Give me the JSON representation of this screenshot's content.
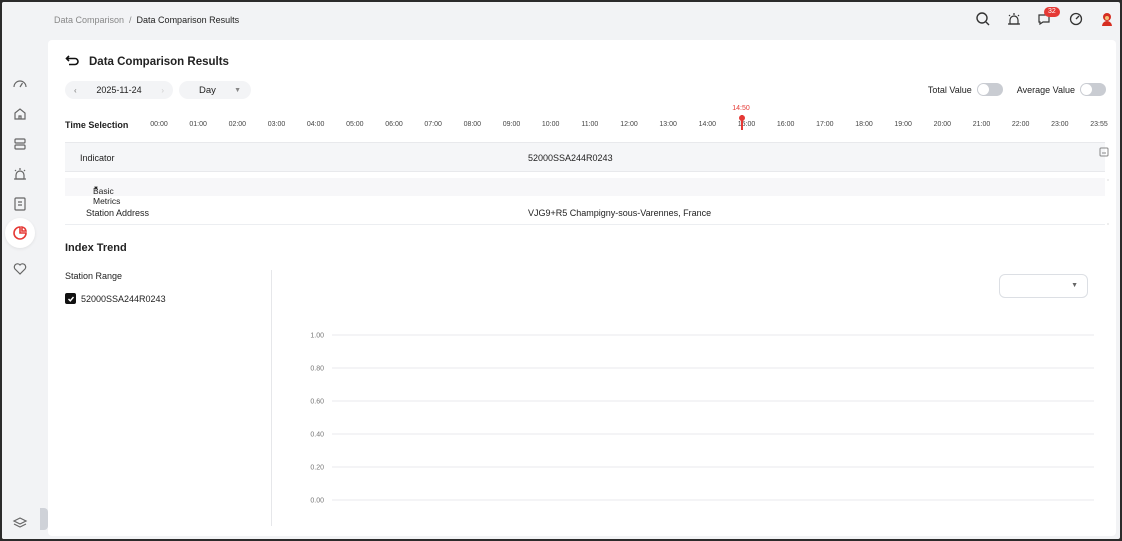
{
  "breadcrumb": {
    "parent": "Data Comparison",
    "separator": "/",
    "current": "Data Comparison Results"
  },
  "header": {
    "notification_count": "32"
  },
  "sidebar": {
    "items": [
      "dashboard-icon",
      "home-icon",
      "ticket-icon",
      "alarm-icon",
      "report-icon",
      "analysis-icon",
      "heart-icon"
    ],
    "active_index": 5
  },
  "page": {
    "title": "Data Comparison Results"
  },
  "date_picker": {
    "value": "2025-11-24",
    "prev": "‹",
    "next": "›"
  },
  "granularity": {
    "value": "Day"
  },
  "toggles": {
    "total_value": "Total Value",
    "average_value": "Average Value"
  },
  "time_selection": {
    "label": "Time Selection",
    "ticks": [
      "00:00",
      "01:00",
      "02:00",
      "03:00",
      "04:00",
      "05:00",
      "06:00",
      "07:00",
      "08:00",
      "09:00",
      "10:00",
      "11:00",
      "12:00",
      "13:00",
      "14:00",
      "15:00",
      "16:00",
      "17:00",
      "18:00",
      "19:00",
      "20:00",
      "21:00",
      "22:00",
      "23:00",
      "23:55"
    ],
    "current": "14:50"
  },
  "table": {
    "header": {
      "col1": "Indicator",
      "col2": "52000SSA244R0243"
    },
    "group": "Basic Metrics",
    "rows": [
      {
        "label": "Station Address",
        "value": "VJG9+R5 Champigny-sous-Varennes, France"
      }
    ]
  },
  "trend": {
    "title": "Index Trend",
    "range_label": "Station Range",
    "stations": [
      {
        "name": "52000SSA244R0243",
        "checked": true
      }
    ],
    "metric_select": ""
  },
  "chart_data": {
    "type": "line",
    "series": [],
    "yticks": [
      "1.00",
      "0.80",
      "0.60",
      "0.40",
      "0.20",
      "0.00"
    ],
    "ylim": [
      0,
      1
    ],
    "grid": true
  },
  "colors": {
    "accent": "#e53935",
    "switch_off": "#c9ccd2",
    "panel": "#ffffff",
    "background": "#f2f3f5"
  }
}
